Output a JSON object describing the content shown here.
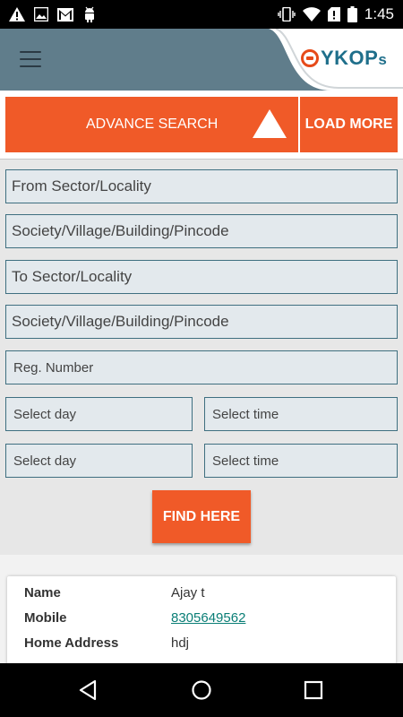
{
  "status_bar": {
    "time": "1:45",
    "left_icons": [
      "alert-icon",
      "image-icon",
      "gmail-icon",
      "android-icon"
    ],
    "right_icons": [
      "vibrate-icon",
      "wifi-icon",
      "no-sim-icon",
      "battery-icon"
    ]
  },
  "app_bar": {
    "logo_main": "YKOP",
    "logo_suffix": "s",
    "background_color": "#607d8b",
    "logo_color": "#1f6f8b"
  },
  "actions": {
    "advance_search": "ADVANCE SEARCH",
    "load_more": "LOAD MORE",
    "accent_color": "#f05a28"
  },
  "search_form": {
    "from_locality": "From Sector/Locality",
    "from_society": "Society/Village/Building/Pincode",
    "to_locality": "To Sector/Locality",
    "to_society": "Society/Village/Building/Pincode",
    "reg_number": "Reg. Number",
    "day_1": "Select day",
    "time_1": "Select time",
    "day_2": "Select day",
    "time_2": "Select time",
    "find_button": "FIND HERE"
  },
  "result_card": {
    "rows": [
      {
        "label": "Name",
        "value": "Ajay t"
      },
      {
        "label": "Mobile",
        "value": "8305649562"
      },
      {
        "label": "Home Address",
        "value": "hdj"
      }
    ],
    "link_color": "#0a7e76"
  },
  "nav_bar": {
    "buttons": [
      "back-icon",
      "home-icon",
      "recents-icon"
    ]
  }
}
